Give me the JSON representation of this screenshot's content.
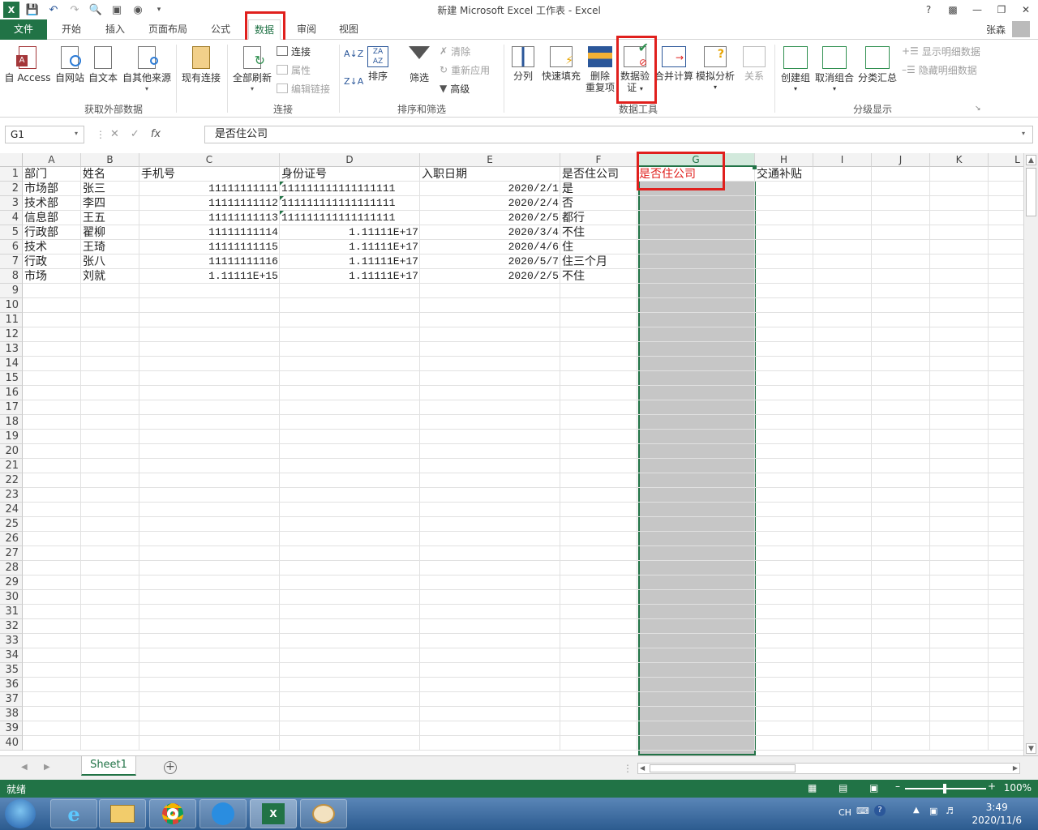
{
  "window": {
    "title": "新建 Microsoft Excel 工作表 - Excel",
    "user": "张森",
    "help": "?"
  },
  "tabs": {
    "file": "文件",
    "items": [
      "开始",
      "插入",
      "页面布局",
      "公式",
      "数据",
      "审阅",
      "视图"
    ],
    "active": "数据"
  },
  "ribbon": {
    "get_external": {
      "access": "自 Access",
      "web": "自网站",
      "text": "自文本",
      "other": "自其他来源",
      "existing": "现有连接",
      "label": "获取外部数据"
    },
    "connections": {
      "refresh_all": "全部刷新",
      "connections": "连接",
      "properties": "属性",
      "edit_links": "编辑链接",
      "label": "连接"
    },
    "sort_filter": {
      "sort": "排序",
      "filter": "筛选",
      "clear": "清除",
      "reapply": "重新应用",
      "advanced": "高级",
      "label": "排序和筛选"
    },
    "data_tools": {
      "text_to_columns": "分列",
      "flash_fill": "快速填充",
      "remove_dup_1": "删除",
      "remove_dup_2": "重复项",
      "validation_1": "数据验",
      "validation_2": "证",
      "consolidate": "合并计算",
      "whatif": "模拟分析",
      "relationships": "关系",
      "label": "数据工具"
    },
    "outline": {
      "group": "创建组",
      "ungroup": "取消组合",
      "subtotal": "分类汇总",
      "show_detail": "显示明细数据",
      "hide_detail": "隐藏明细数据",
      "label": "分级显示"
    }
  },
  "formula_bar": {
    "name_box": "G1",
    "fx": "fx",
    "content": "是否住公司"
  },
  "columns": [
    "A",
    "B",
    "C",
    "D",
    "E",
    "F",
    "G",
    "H",
    "I",
    "J",
    "K",
    "L"
  ],
  "rows": [
    "1",
    "2",
    "3",
    "4",
    "5",
    "6",
    "7",
    "8",
    "9",
    "10",
    "11",
    "12",
    "13",
    "14",
    "15",
    "16",
    "17",
    "18",
    "19",
    "20",
    "21",
    "22",
    "23",
    "24",
    "25",
    "26",
    "27",
    "28",
    "29",
    "30",
    "31",
    "32",
    "33",
    "34",
    "35",
    "36",
    "37",
    "38",
    "39",
    "40"
  ],
  "table": {
    "headers": [
      "部门",
      "姓名",
      "手机号",
      "身份证号",
      "入职日期",
      "是否住公司",
      "是否住公司",
      "交通补贴"
    ],
    "data": [
      [
        "市场部",
        "张三",
        "11111111111",
        "111111111111111111",
        "2020/2/1",
        "是"
      ],
      [
        "技术部",
        "李四",
        "11111111112",
        "111111111111111111",
        "2020/2/4",
        "否"
      ],
      [
        "信息部",
        "王五",
        "11111111113",
        "111111111111111111",
        "2020/2/5",
        "都行"
      ],
      [
        "行政部",
        "翟柳",
        "11111111114",
        "1.11111E+17",
        "2020/3/4",
        "不住"
      ],
      [
        "技术",
        "王琦",
        "11111111115",
        "1.11111E+17",
        "2020/4/6",
        "住"
      ],
      [
        "行政",
        "张八",
        "11111111116",
        "1.11111E+17",
        "2020/5/7",
        "住三个月"
      ],
      [
        "市场",
        "刘就",
        "1.11111E+15",
        "1.11111E+17",
        "2020/2/5",
        "不住"
      ]
    ]
  },
  "sheet": {
    "name": "Sheet1",
    "add": "+"
  },
  "status": {
    "ready": "就绪",
    "zoom": "100%"
  },
  "taskbar": {
    "time": "3:49",
    "date": "2020/11/6",
    "lang": "CH"
  },
  "colors": {
    "excel_green": "#217346",
    "highlight_red": "#e0201d",
    "selection_gray": "#c6c6c6"
  }
}
